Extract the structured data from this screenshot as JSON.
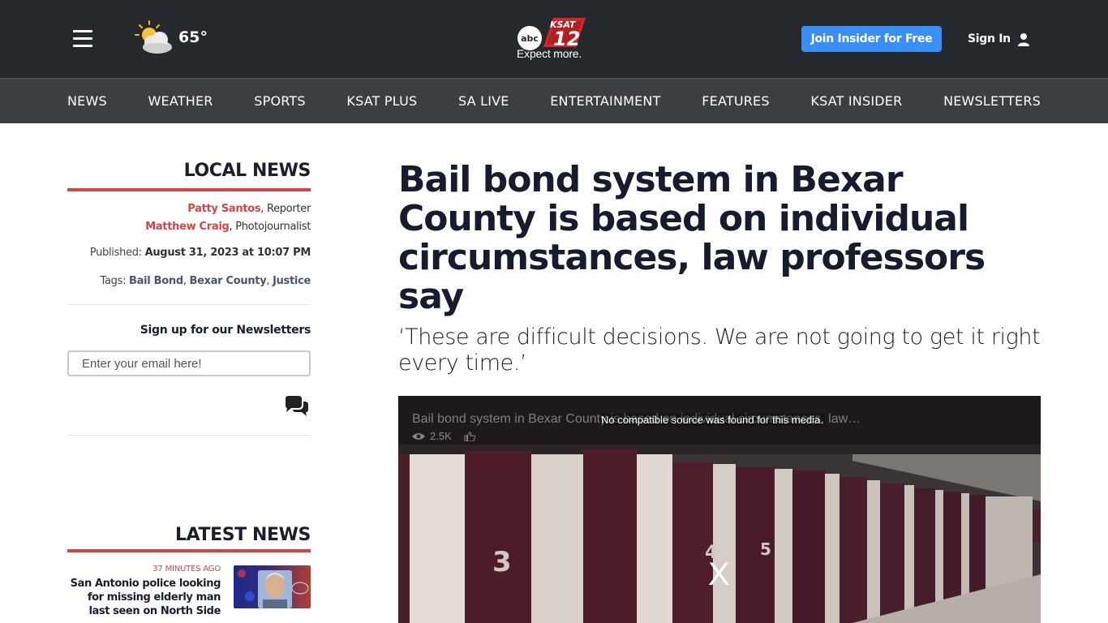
{
  "header": {
    "weather": {
      "temperature": "65°",
      "icon": "partly-cloudy-icon"
    },
    "logo": {
      "network": "abc",
      "station": "KSAT",
      "channel": "12",
      "tagline": "Expect more."
    },
    "join_button": "Join Insider for Free",
    "sign_in": "Sign In",
    "colors": {
      "bar": "#25282d",
      "accent": "#3a8ff7"
    }
  },
  "nav": {
    "items": [
      "NEWS",
      "WEATHER",
      "SPORTS",
      "KSAT PLUS",
      "SA LIVE",
      "ENTERTAINMENT",
      "FEATURES",
      "KSAT INSIDER",
      "NEWSLETTERS"
    ]
  },
  "sidebar": {
    "section_title": "LOCAL NEWS",
    "authors": [
      {
        "name": "Patty Santos",
        "role": ", Reporter"
      },
      {
        "name": "Matthew Craig",
        "role": ", Photojournalist"
      }
    ],
    "published_label": "Published: ",
    "published_date": "August 31, 2023 at 10:07 PM",
    "tags_label": "Tags: ",
    "tags": [
      "Bail Bond",
      "Bexar County",
      "Justice"
    ],
    "tag_separator": ", ",
    "newsletter_label": "Sign up for our Newsletters",
    "email_placeholder": "Enter your email here!",
    "latest_title": "LATEST NEWS",
    "latest_items": [
      {
        "time": "37 MINUTES AGO",
        "headline": "San Antonio police looking for missing elderly man last seen on North Side"
      }
    ],
    "accent_color": "#d64545"
  },
  "article": {
    "headline": "Bail bond system in Bexar County is based on individual circumstances, law professors say",
    "subheadline": "‘These are difficult decisions. We are not going to get it right every time.’"
  },
  "video": {
    "title": "Bail bond system in Bexar County is based on individual circumstances, law…",
    "views": "2.5K",
    "error": "No compatible source was found for this media.",
    "close": "X",
    "door_numbers": [
      "3",
      "4",
      "5"
    ]
  }
}
